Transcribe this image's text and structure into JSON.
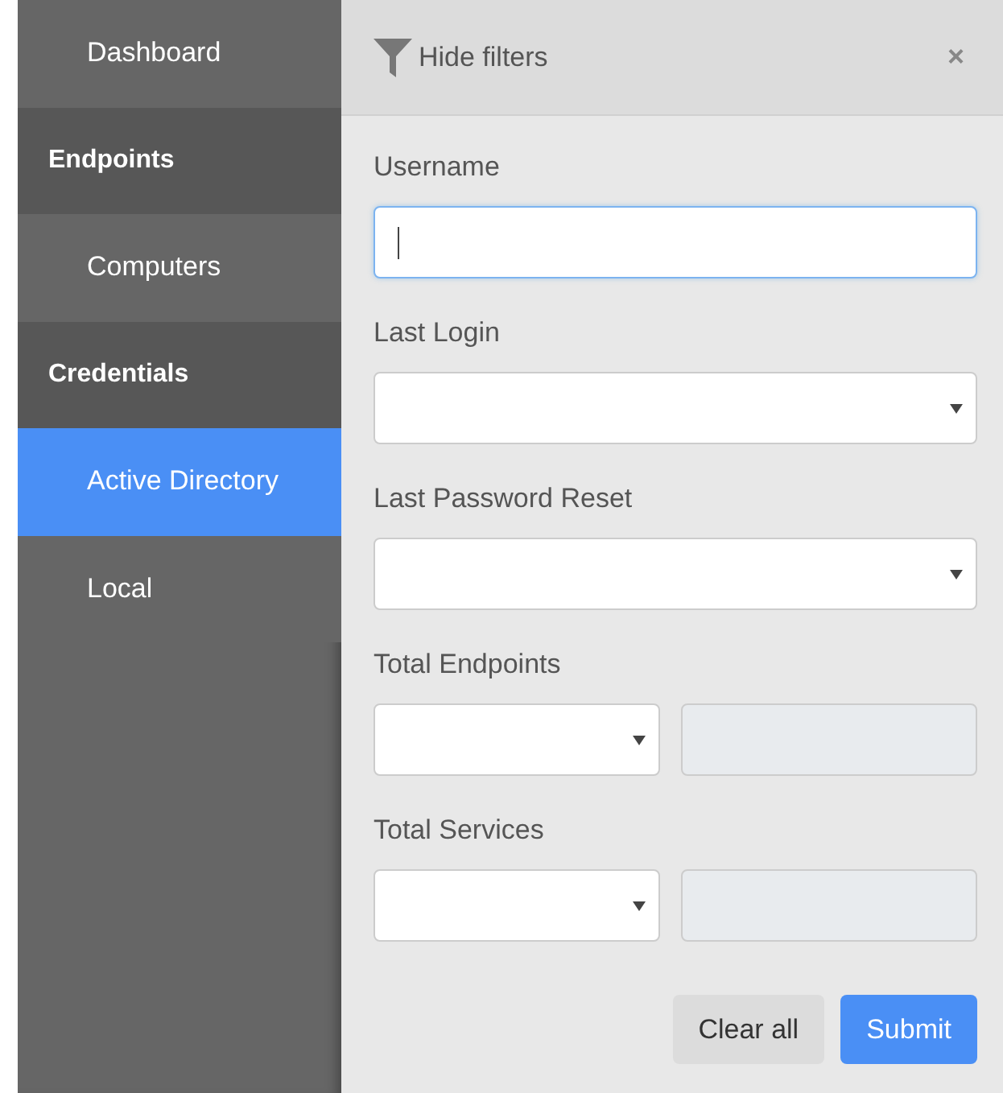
{
  "sidebar": {
    "items": [
      {
        "kind": "link",
        "label": "Dashboard",
        "selected": false
      },
      {
        "kind": "header",
        "label": "Endpoints"
      },
      {
        "kind": "link",
        "label": "Computers",
        "selected": false
      },
      {
        "kind": "header",
        "label": "Credentials"
      },
      {
        "kind": "link",
        "label": "Active Directory",
        "selected": true
      },
      {
        "kind": "link",
        "label": "Local",
        "selected": false
      }
    ]
  },
  "filters": {
    "title": "Hide filters",
    "close": "×",
    "fields": [
      {
        "kind": "text",
        "label": "Username",
        "focused": true
      },
      {
        "kind": "select",
        "label": "Last Login"
      },
      {
        "kind": "select",
        "label": "Last Password Reset"
      },
      {
        "kind": "range",
        "label": "Total Endpoints"
      },
      {
        "kind": "range",
        "label": "Total Services"
      }
    ],
    "buttons": [
      {
        "kind": "secondary",
        "label": "Clear all"
      },
      {
        "kind": "primary",
        "label": "Submit"
      }
    ]
  }
}
